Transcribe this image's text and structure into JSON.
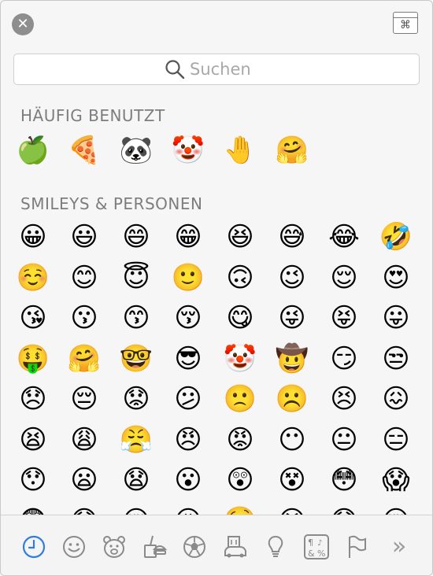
{
  "header": {
    "close_glyph": "✕",
    "viewer_glyph": "⌘"
  },
  "search": {
    "placeholder": "Suchen",
    "value": ""
  },
  "frequent": {
    "title": "HÄUFIG BENUTZT",
    "emojis": [
      "🍏",
      "🍕",
      "🐼",
      "🤡",
      "🤚",
      "🤗"
    ]
  },
  "smileys": {
    "title": "SMILEYS & PERSONEN",
    "emojis": [
      "😀",
      "😃",
      "😄",
      "😁",
      "😆",
      "😅",
      "😂",
      "🤣",
      "☺️",
      "😊",
      "😇",
      "🙂",
      "🙃",
      "😉",
      "😌",
      "😍",
      "😘",
      "😗",
      "😙",
      "😚",
      "😋",
      "😜",
      "😝",
      "😛",
      "🤑",
      "🤗",
      "🤓",
      "😎",
      "🤡",
      "🤠",
      "😏",
      "😒",
      "😞",
      "😔",
      "😟",
      "😕",
      "🙁",
      "☹️",
      "😣",
      "😖",
      "😫",
      "😩",
      "😤",
      "😠",
      "😡",
      "😶",
      "😐",
      "😑",
      "😯",
      "😦",
      "😧",
      "😮",
      "😲",
      "😵",
      "😳",
      "😱",
      "😨",
      "😰",
      "😢",
      "😥",
      "🤤",
      "😭",
      "😓",
      "😪"
    ]
  },
  "categories": [
    {
      "name": "clock-icon",
      "active": true
    },
    {
      "name": "smiley-icon"
    },
    {
      "name": "bear-icon"
    },
    {
      "name": "food-icon"
    },
    {
      "name": "soccer-icon"
    },
    {
      "name": "building-icon"
    },
    {
      "name": "lightbulb-icon"
    },
    {
      "name": "symbols-icon"
    },
    {
      "name": "flag-icon"
    },
    {
      "name": "more-chevron-icon"
    }
  ],
  "colors": {
    "accent": "#2f7de1",
    "icon_gray": "#8a8a8a"
  }
}
